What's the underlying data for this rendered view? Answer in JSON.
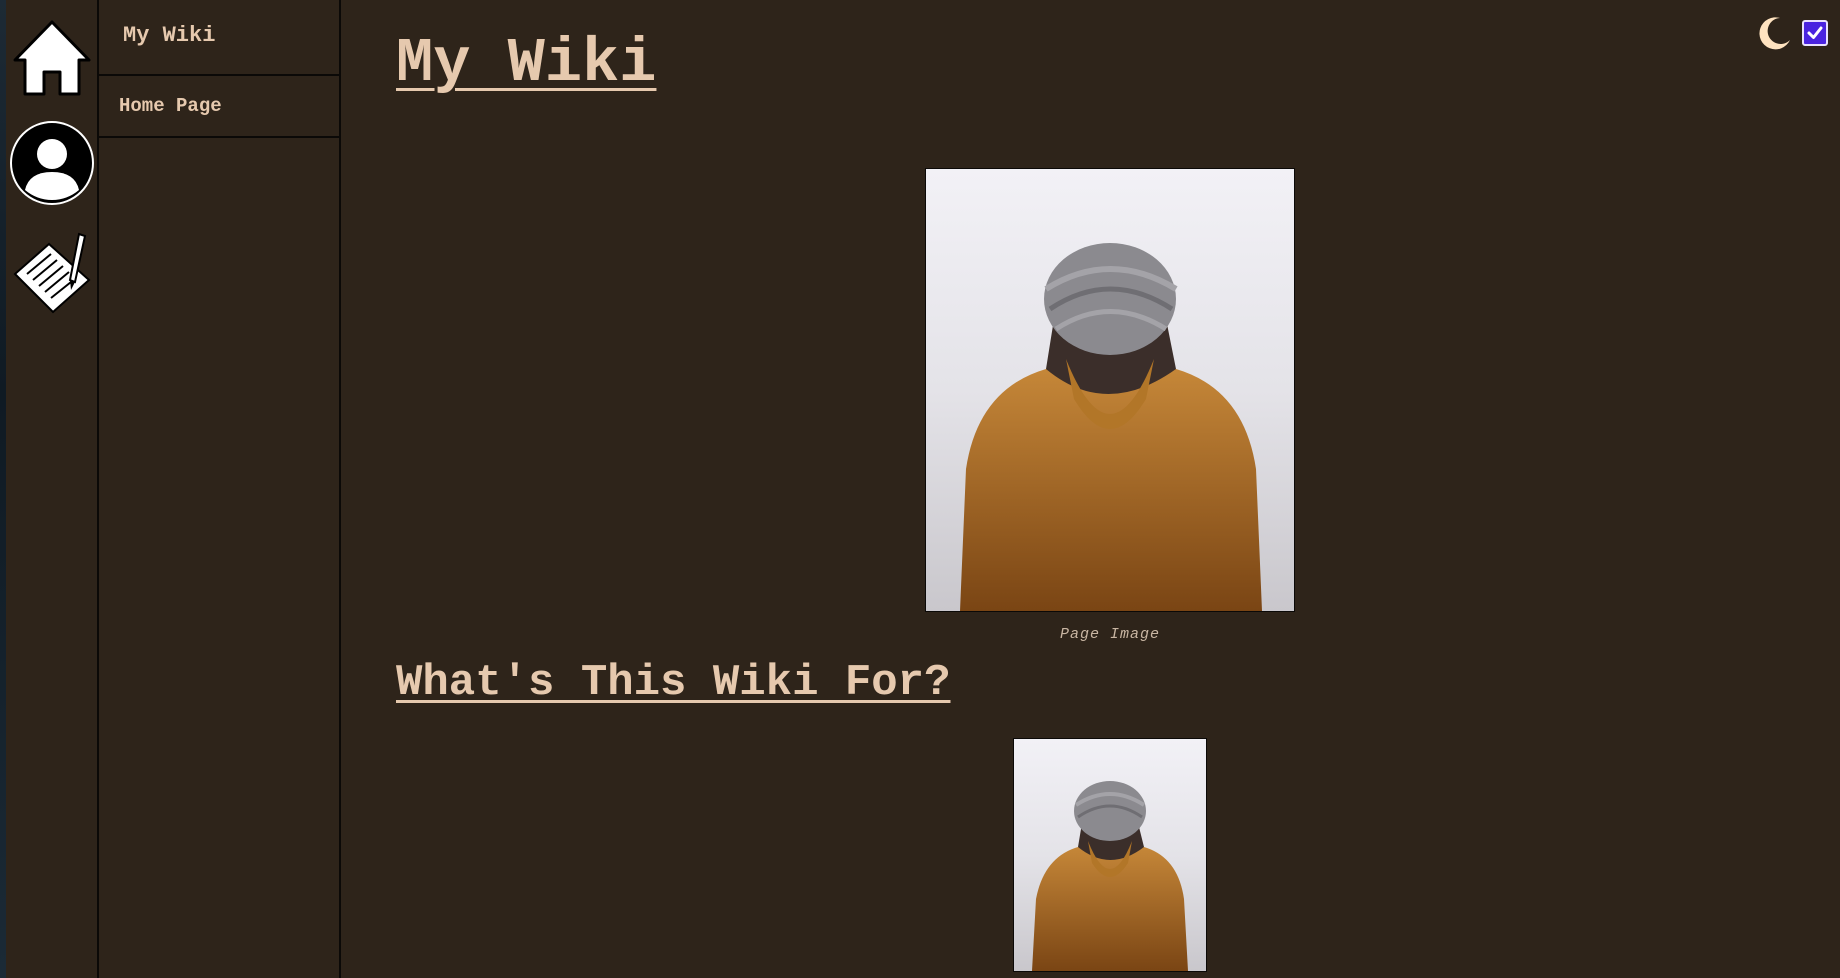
{
  "icons": {
    "home": "home-icon",
    "user": "user-avatar-icon",
    "edit": "edit-document-icon",
    "theme": "moon-icon"
  },
  "sidebar": {
    "title": "My Wiki",
    "items": [
      {
        "label": "Home Page"
      }
    ]
  },
  "main": {
    "title": "My Wiki",
    "figure": {
      "caption": "Page Image"
    },
    "sections": [
      {
        "heading": "What's This Wiki For?"
      }
    ]
  },
  "theme": {
    "dark_mode_checked": true,
    "accent": "#4a23e0",
    "background": "#2e241a",
    "text": "#e6c9ae"
  }
}
